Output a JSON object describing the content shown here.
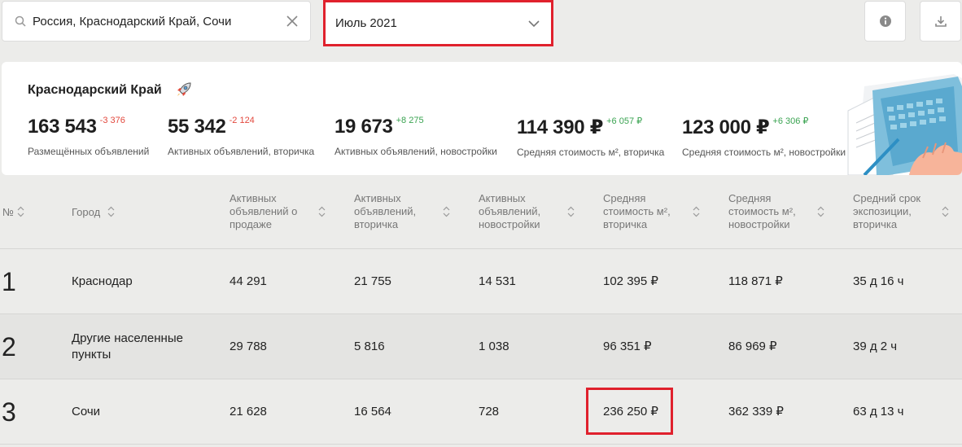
{
  "search": {
    "value": "Россия, Краснодарский Край, Сочи"
  },
  "month": {
    "value": "Июль 2021"
  },
  "region": {
    "title": "Краснодарский Край"
  },
  "stats": [
    {
      "value": "163 543",
      "delta": "-3 376",
      "label": "Размещённых объявлений"
    },
    {
      "value": "55 342",
      "delta": "-2 124",
      "label": "Активных объявлений, вторичка"
    },
    {
      "value": "19 673",
      "delta": "+8 275",
      "label": "Активных объявлений, новостройки"
    },
    {
      "value": "114 390 ₽",
      "delta": "+6 057 ₽",
      "label": "Средняя стоимость м², вторичка"
    },
    {
      "value": "123 000 ₽",
      "delta": "+6 306 ₽",
      "label": "Средняя стоимость м², новостройки"
    }
  ],
  "table": {
    "headers": {
      "num": "№",
      "city": "Город",
      "active_sale": [
        "Активных",
        "объявлений о",
        "продаже"
      ],
      "active_secondary": [
        "Активных",
        "объявлений,",
        "вторичка"
      ],
      "active_new": [
        "Активных",
        "объявлений,",
        "новостройки"
      ],
      "avg_secondary": [
        "Средняя",
        "стоимость м²,",
        "вторичка"
      ],
      "avg_new": [
        "Средняя",
        "стоимость м²,",
        "новостройки"
      ],
      "exposure": [
        "Средний срок",
        "экспозиции,",
        "вторичка"
      ]
    },
    "rows": [
      {
        "num": "1",
        "city": "Краснодар",
        "active_sale": "44 291",
        "active_secondary": "21 755",
        "active_new": "14 531",
        "avg_secondary": "102 395 ₽",
        "avg_new": "118 871 ₽",
        "exposure": "35 д 16 ч"
      },
      {
        "num": "2",
        "city": "Другие населенные пункты",
        "active_sale": "29 788",
        "active_secondary": "5 816",
        "active_new": "1 038",
        "avg_secondary": "96 351 ₽",
        "avg_new": "86 969 ₽",
        "exposure": "39 д 2 ч"
      },
      {
        "num": "3",
        "city": "Сочи",
        "active_sale": "21 628",
        "active_secondary": "16 564",
        "active_new": "728",
        "avg_secondary": "236 250 ₽",
        "avg_new": "362 339 ₽",
        "exposure": "63 д 13 ч"
      }
    ]
  },
  "colors": {
    "highlight": "#e0212d",
    "negative": "#e2483d",
    "positive": "#3aa351"
  }
}
